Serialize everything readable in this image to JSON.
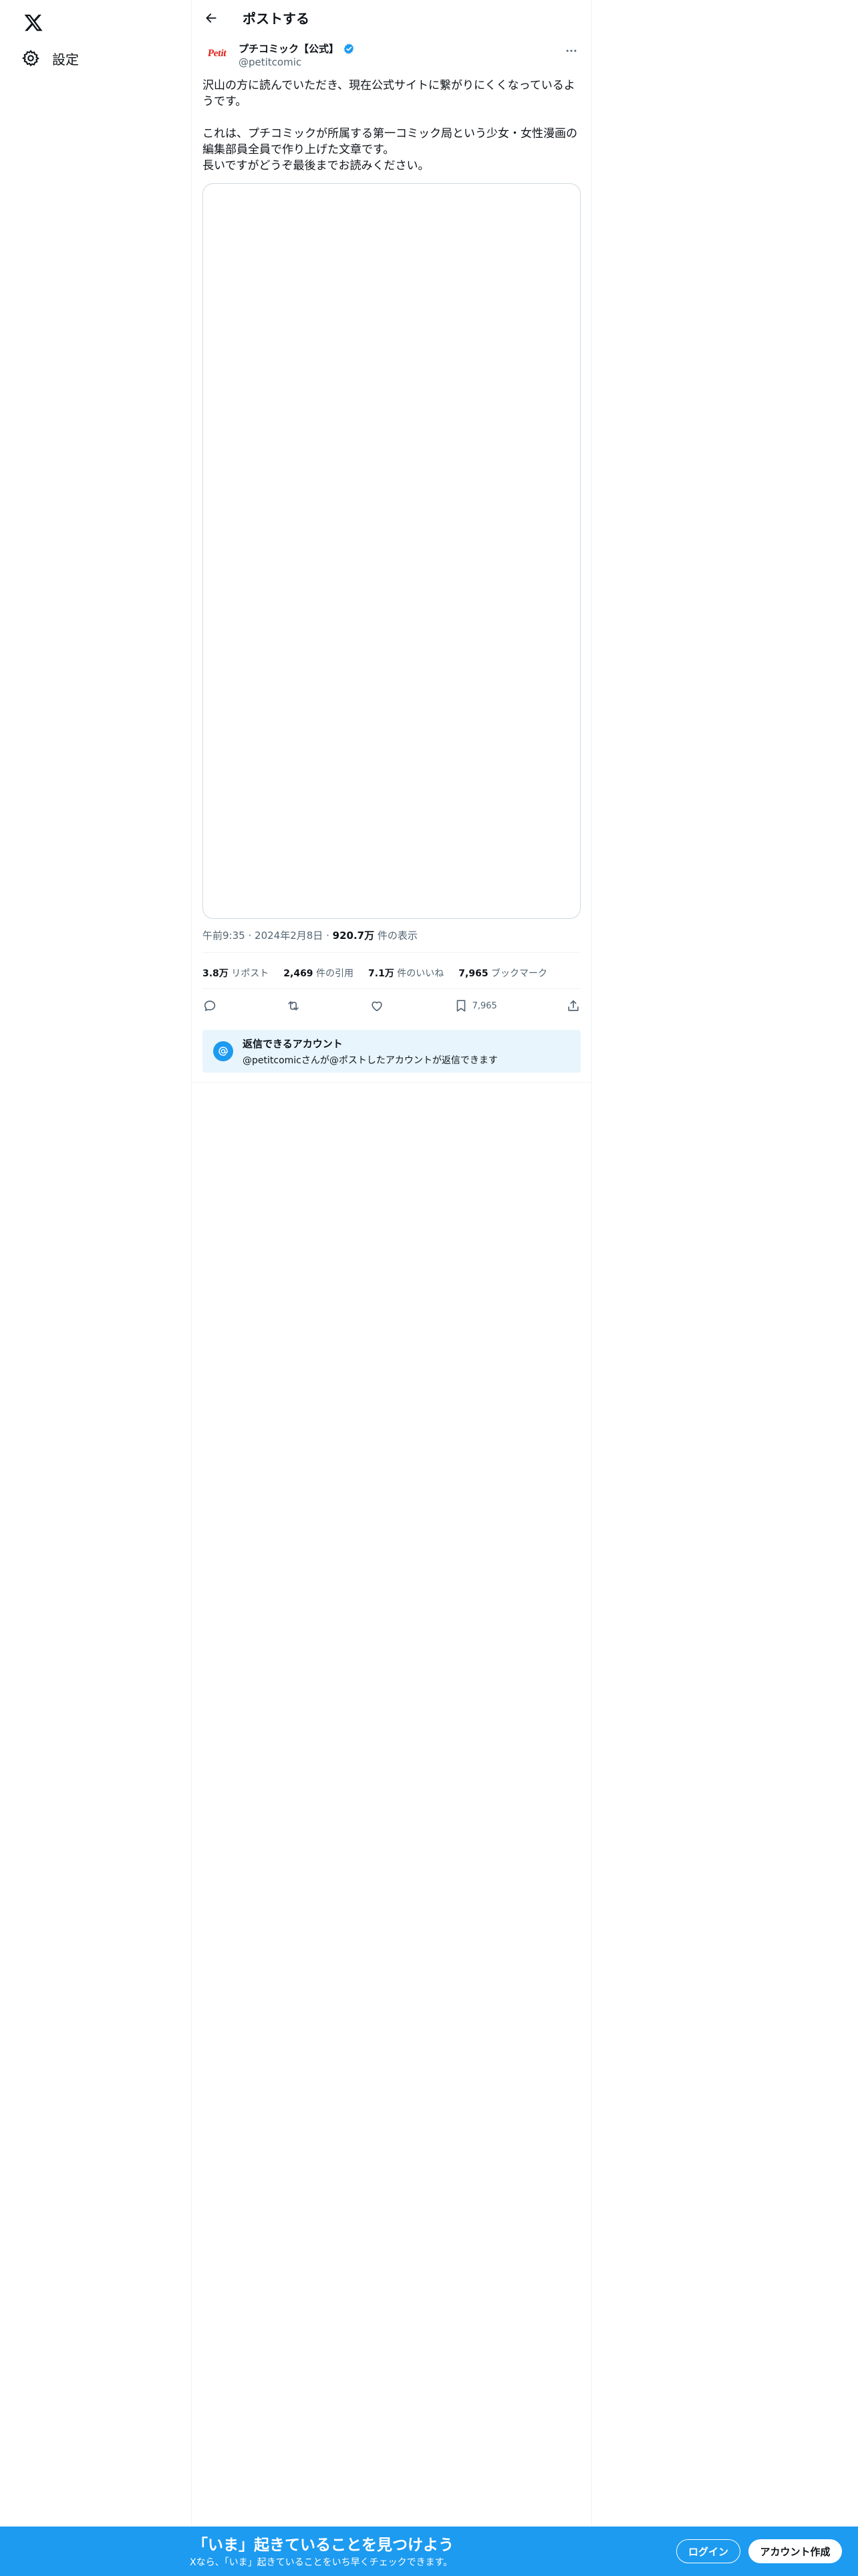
{
  "sidebar": {
    "logo_icon": "x-logo-icon",
    "items": [
      {
        "label": "設定",
        "icon": "gear-icon"
      }
    ]
  },
  "header": {
    "back_icon": "arrow-left-icon",
    "title": "ポストする"
  },
  "post": {
    "avatar_text": "Petit",
    "display_name": "プチコミック【公式】",
    "verified_icon": "verified-badge-icon",
    "handle": "@petitcomic",
    "more_icon": "more-dots-icon",
    "text": "沢山の方に読んでいただき、現在公式サイトに繋がりにくくなっているようです。\n\nこれは、プチコミックが所属する第一コミック局という少女・女性漫画の編集部員全員で作り上げた文章です。\n長いですがどうぞ最後までお読みください。",
    "meta": {
      "time": "午前9:35",
      "date": "2024年2月8日",
      "views_value": "920.7万",
      "views_label": "件の表示",
      "separator": "·"
    },
    "stats": {
      "reposts_value": "3.8万",
      "reposts_label": "リポスト",
      "quotes_value": "2,469",
      "quotes_label": "件の引用",
      "likes_value": "7.1万",
      "likes_label": "件のいいね",
      "bookmarks_value": "7,965",
      "bookmarks_label": "ブックマーク"
    },
    "actions": {
      "reply_icon": "reply-icon",
      "repost_icon": "repost-icon",
      "like_icon": "heart-icon",
      "bookmark_icon": "bookmark-icon",
      "bookmark_count": "7,965",
      "share_icon": "share-icon"
    },
    "reply_notice": {
      "icon": "at-icon",
      "title": "返信できるアカウント",
      "desc": "@petitcomicさんが@ポストしたアカウントが返信できます"
    }
  },
  "bottom_bar": {
    "headline": "「いま」起きていることを見つけよう",
    "sub": "Xなら、「いま」起きていることをいち早くチェックできます。",
    "login": "ログイン",
    "signup": "アカウント作成"
  },
  "colors": {
    "accent": "#1d9bf0",
    "text": "#0f1419",
    "muted": "#536471",
    "notice_bg": "#e8f5fd"
  }
}
